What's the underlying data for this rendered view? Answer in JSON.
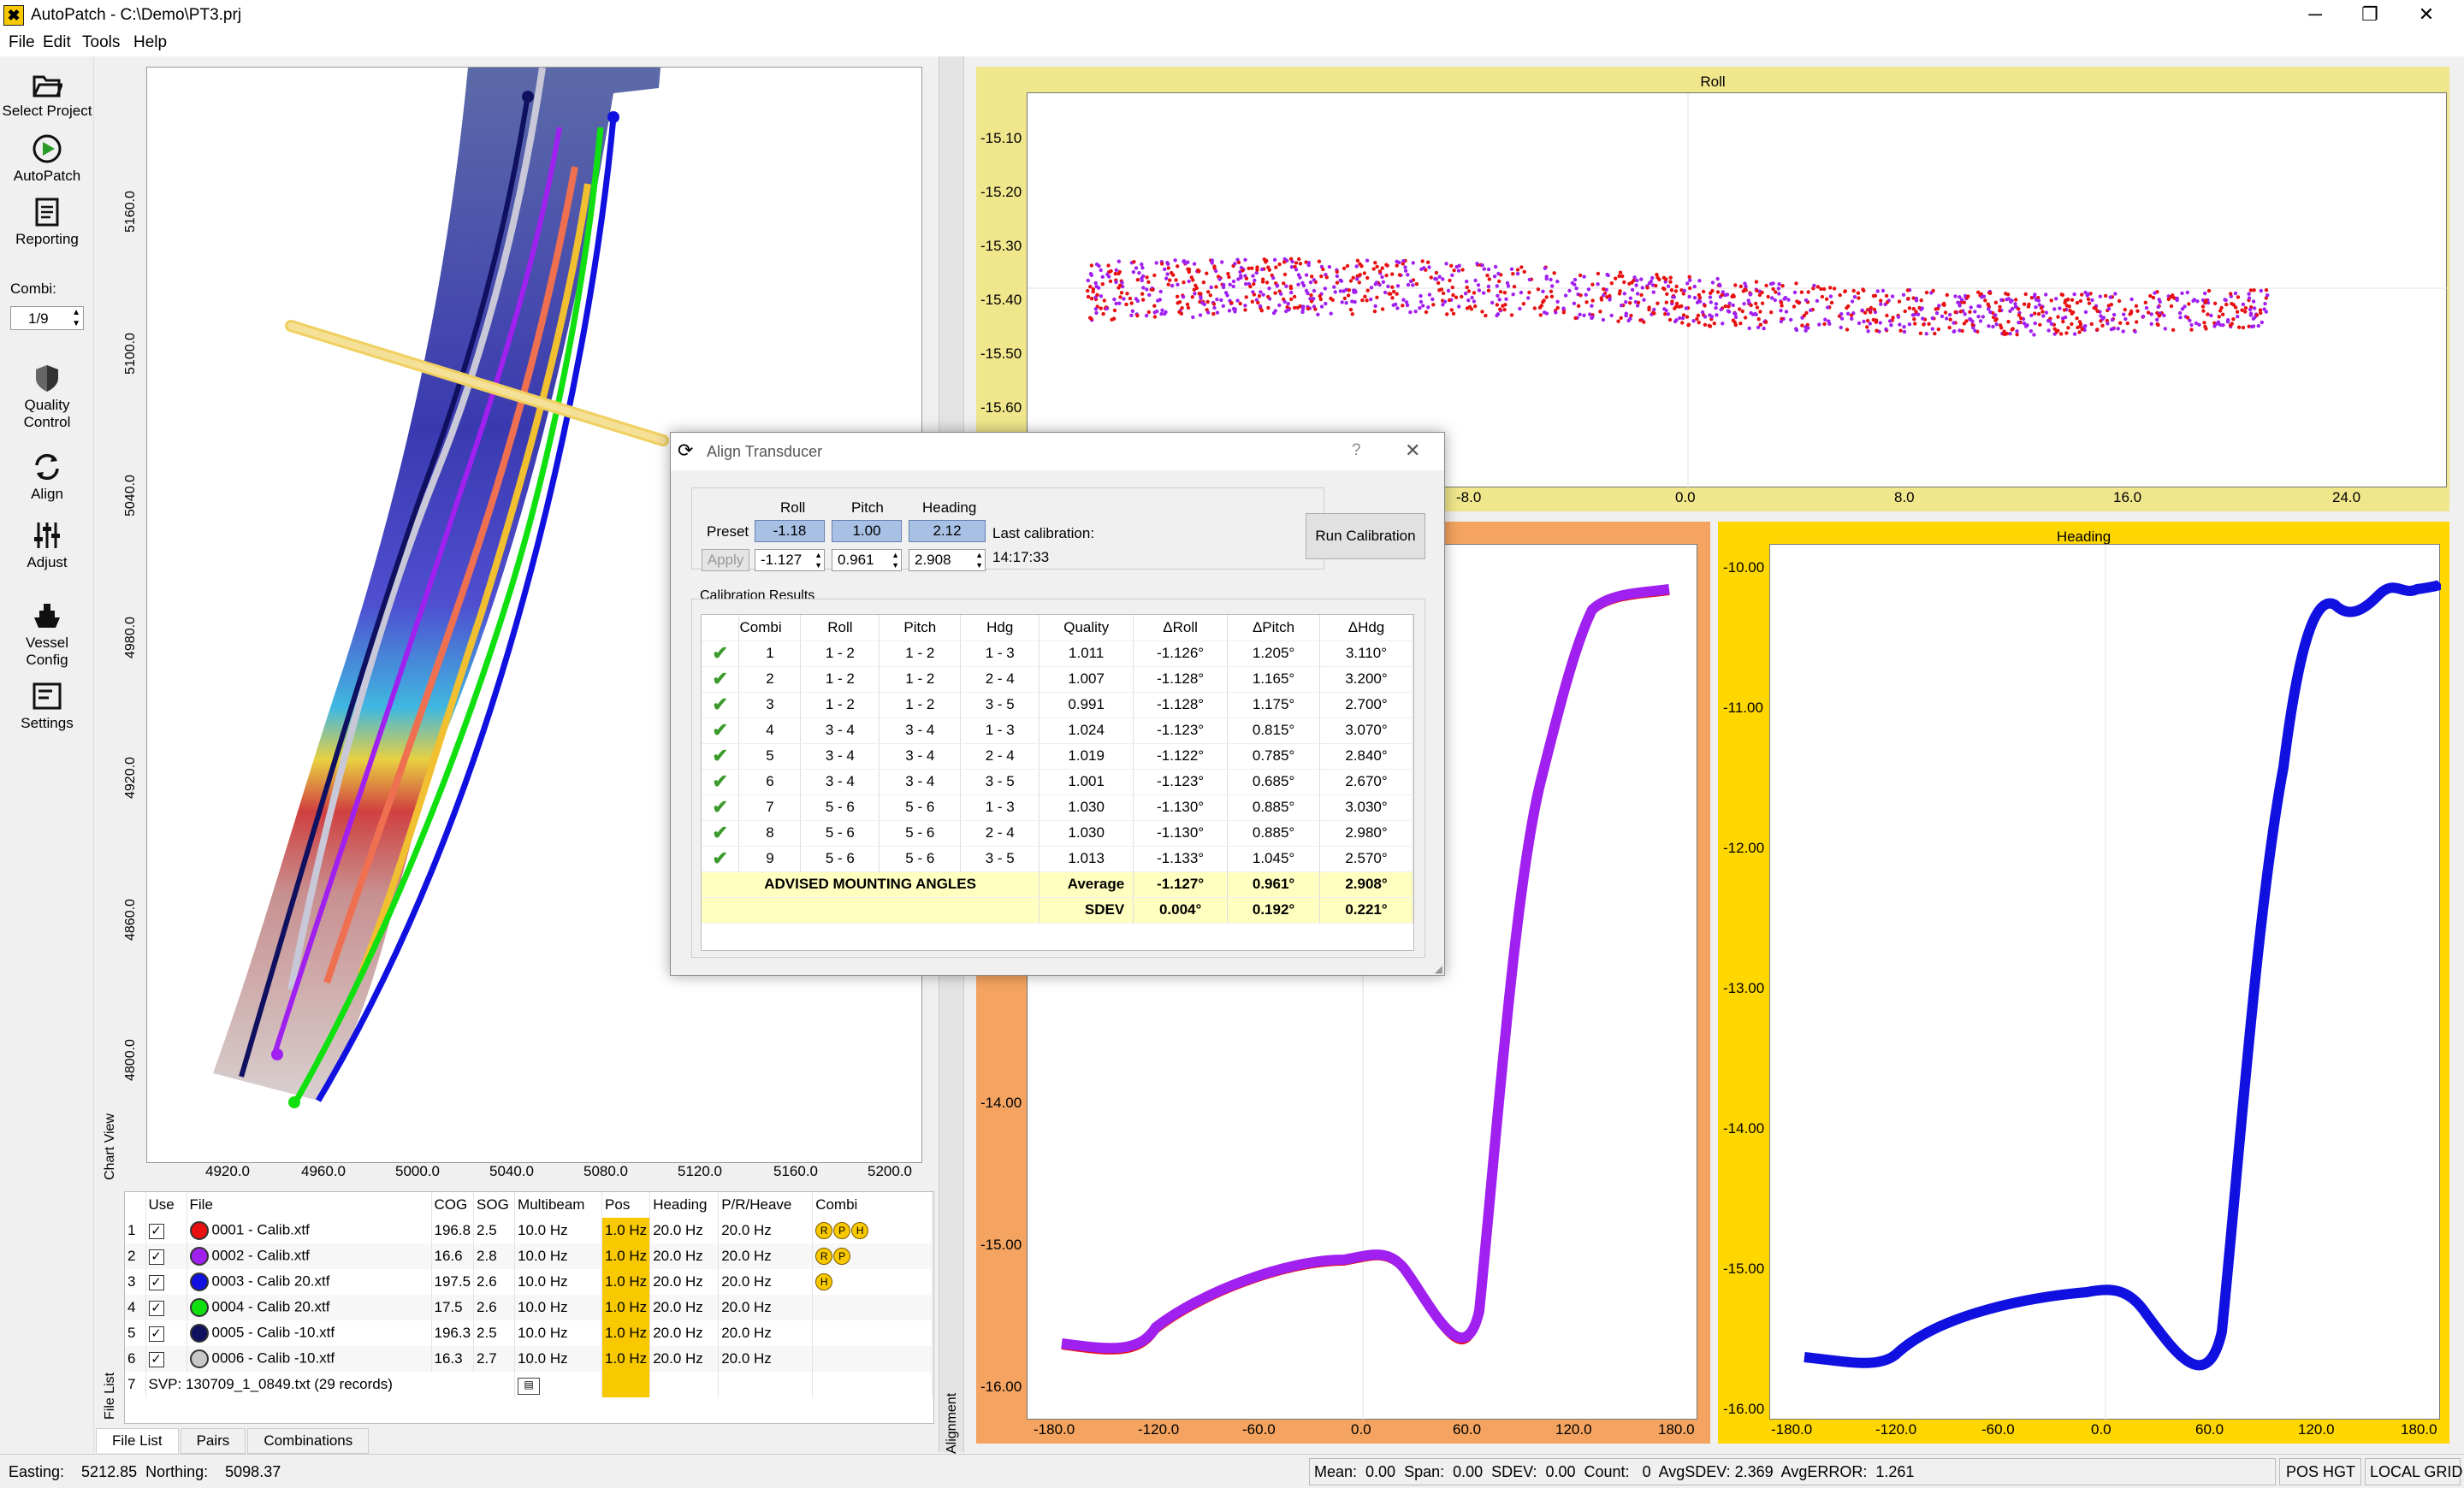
{
  "window": {
    "title": "AutoPatch - C:\\Demo\\PT3.prj"
  },
  "menu": [
    "File",
    "Edit",
    "Tools",
    "Help"
  ],
  "toolbar": {
    "select_project": "Select Project",
    "autopatch": "AutoPatch",
    "reporting": "Reporting",
    "combi_label": "Combi:",
    "combi_value": "1/9",
    "quality_control": "Quality Control",
    "align": "Align",
    "adjust": "Adjust",
    "vessel_config": "Vessel Config",
    "settings": "Settings"
  },
  "chart_view": {
    "label": "Chart View",
    "x_ticks": [
      "4920.0",
      "4960.0",
      "5000.0",
      "5040.0",
      "5080.0",
      "5120.0",
      "5160.0",
      "5200.0"
    ],
    "y_ticks": [
      "5160.0",
      "5100.0",
      "5040.0",
      "4980.0",
      "4920.0",
      "4860.0",
      "4800.0"
    ]
  },
  "file_list": {
    "side_label": "File List",
    "headers": [
      "Use",
      "File",
      "COG",
      "SOG",
      "Multibeam",
      "Pos",
      "Heading",
      "P/R/Heave",
      "Combi"
    ],
    "rows": [
      {
        "n": "1",
        "file": "0001 - Calib.xtf",
        "color": "#e81010",
        "cog": "196.8",
        "sog": "2.5",
        "mb": "10.0 Hz",
        "pos": "1.0 Hz",
        "hdg": "20.0 Hz",
        "prh": "20.0 Hz",
        "combi": [
          "R",
          "P",
          "H"
        ]
      },
      {
        "n": "2",
        "file": "0002 - Calib.xtf",
        "color": "#a020f0",
        "cog": "16.6",
        "sog": "2.8",
        "mb": "10.0 Hz",
        "pos": "1.0 Hz",
        "hdg": "20.0 Hz",
        "prh": "20.0 Hz",
        "combi": [
          "R",
          "P"
        ]
      },
      {
        "n": "3",
        "file": "0003 - Calib 20.xtf",
        "color": "#1010e0",
        "cog": "197.5",
        "sog": "2.6",
        "mb": "10.0 Hz",
        "pos": "1.0 Hz",
        "hdg": "20.0 Hz",
        "prh": "20.0 Hz",
        "combi": [
          "H"
        ]
      },
      {
        "n": "4",
        "file": "0004 - Calib 20.xtf",
        "color": "#10e010",
        "cog": "17.5",
        "sog": "2.6",
        "mb": "10.0 Hz",
        "pos": "1.0 Hz",
        "hdg": "20.0 Hz",
        "prh": "20.0 Hz",
        "combi": []
      },
      {
        "n": "5",
        "file": "0005 - Calib -10.xtf",
        "color": "#101060",
        "cog": "196.3",
        "sog": "2.5",
        "mb": "10.0 Hz",
        "pos": "1.0 Hz",
        "hdg": "20.0 Hz",
        "prh": "20.0 Hz",
        "combi": []
      },
      {
        "n": "6",
        "file": "0006 - Calib -10.xtf",
        "color": "#c8c8c8",
        "cog": "16.3",
        "sog": "2.7",
        "mb": "10.0 Hz",
        "pos": "1.0 Hz",
        "hdg": "20.0 Hz",
        "prh": "20.0 Hz",
        "combi": []
      }
    ],
    "svp_n": "7",
    "svp": "SVP:  130709_1_0849.txt (29 records)",
    "tabs": [
      "File List",
      "Pairs",
      "Combinations"
    ]
  },
  "plots": {
    "side_label": "Alignment",
    "roll": {
      "title": "Roll",
      "y_ticks": [
        "-15.10",
        "-15.20",
        "-15.30",
        "-15.40",
        "-15.50",
        "-15.60"
      ],
      "x_ticks": [
        "-8.0",
        "0.0",
        "8.0",
        "16.0",
        "24.0"
      ]
    },
    "pitch": {
      "y_ticks": [
        "-14.00",
        "-15.00",
        "-16.00"
      ],
      "x_ticks": [
        "-180.0",
        "-120.0",
        "-60.0",
        "0.0",
        "60.0",
        "120.0",
        "180.0"
      ]
    },
    "heading": {
      "title": "Heading",
      "y_ticks": [
        "-10.00",
        "-11.00",
        "-12.00",
        "-13.00",
        "-14.00",
        "-15.00",
        "-16.00"
      ],
      "x_ticks": [
        "-180.0",
        "-120.0",
        "-60.0",
        "0.0",
        "60.0",
        "120.0",
        "180.0"
      ]
    }
  },
  "dialog": {
    "title": "Align Transducer",
    "help": "?",
    "close": "✕",
    "col_roll": "Roll",
    "col_pitch": "Pitch",
    "col_heading": "Heading",
    "preset_label": "Preset",
    "preset_roll": "-1.18",
    "preset_pitch": "1.00",
    "preset_heading": "2.12",
    "apply": "Apply",
    "val_roll": "-1.127",
    "val_pitch": "0.961",
    "val_heading": "2.908",
    "last_cal_label": "Last calibration:",
    "last_cal_time": "14:17:33",
    "run_button": "Run Calibration",
    "results_label": "Calibration Results",
    "headers": [
      "Combi",
      "Roll",
      "Pitch",
      "Hdg",
      "Quality",
      "ΔRoll",
      "ΔPitch",
      "ΔHdg"
    ],
    "rows": [
      [
        "1",
        "1 - 2",
        "1 - 2",
        "1 - 3",
        "1.011",
        "-1.126°",
        "1.205°",
        "3.110°"
      ],
      [
        "2",
        "1 - 2",
        "1 - 2",
        "2 - 4",
        "1.007",
        "-1.128°",
        "1.165°",
        "3.200°"
      ],
      [
        "3",
        "1 - 2",
        "1 - 2",
        "3 - 5",
        "0.991",
        "-1.128°",
        "1.175°",
        "2.700°"
      ],
      [
        "4",
        "3 - 4",
        "3 - 4",
        "1 - 3",
        "1.024",
        "-1.123°",
        "0.815°",
        "3.070°"
      ],
      [
        "5",
        "3 - 4",
        "3 - 4",
        "2 - 4",
        "1.019",
        "-1.122°",
        "0.785°",
        "2.840°"
      ],
      [
        "6",
        "3 - 4",
        "3 - 4",
        "3 - 5",
        "1.001",
        "-1.123°",
        "0.685°",
        "2.670°"
      ],
      [
        "7",
        "5 - 6",
        "5 - 6",
        "1 - 3",
        "1.030",
        "-1.130°",
        "0.885°",
        "3.030°"
      ],
      [
        "8",
        "5 - 6",
        "5 - 6",
        "2 - 4",
        "1.030",
        "-1.130°",
        "0.885°",
        "2.980°"
      ],
      [
        "9",
        "5 - 6",
        "5 - 6",
        "3 - 5",
        "1.013",
        "-1.133°",
        "1.045°",
        "2.570°"
      ]
    ],
    "advised_label": "ADVISED MOUNTING ANGLES",
    "average_label": "Average",
    "avg_roll": "-1.127°",
    "avg_pitch": "0.961°",
    "avg_hdg": "2.908°",
    "sdev_label": "SDEV",
    "sdev_roll": "0.004°",
    "sdev_pitch": "0.192°",
    "sdev_hdg": "0.221°"
  },
  "status": {
    "easting": "Easting:    5212.85  Northing:    5098.37",
    "stats": "Mean:  0.00  Span:  0.00  SDEV:  0.00  Count:   0  AvgSDEV: 2.369  AvgERROR:  1.261",
    "pos_hgt": "POS HGT",
    "grid": "LOCAL GRID"
  }
}
